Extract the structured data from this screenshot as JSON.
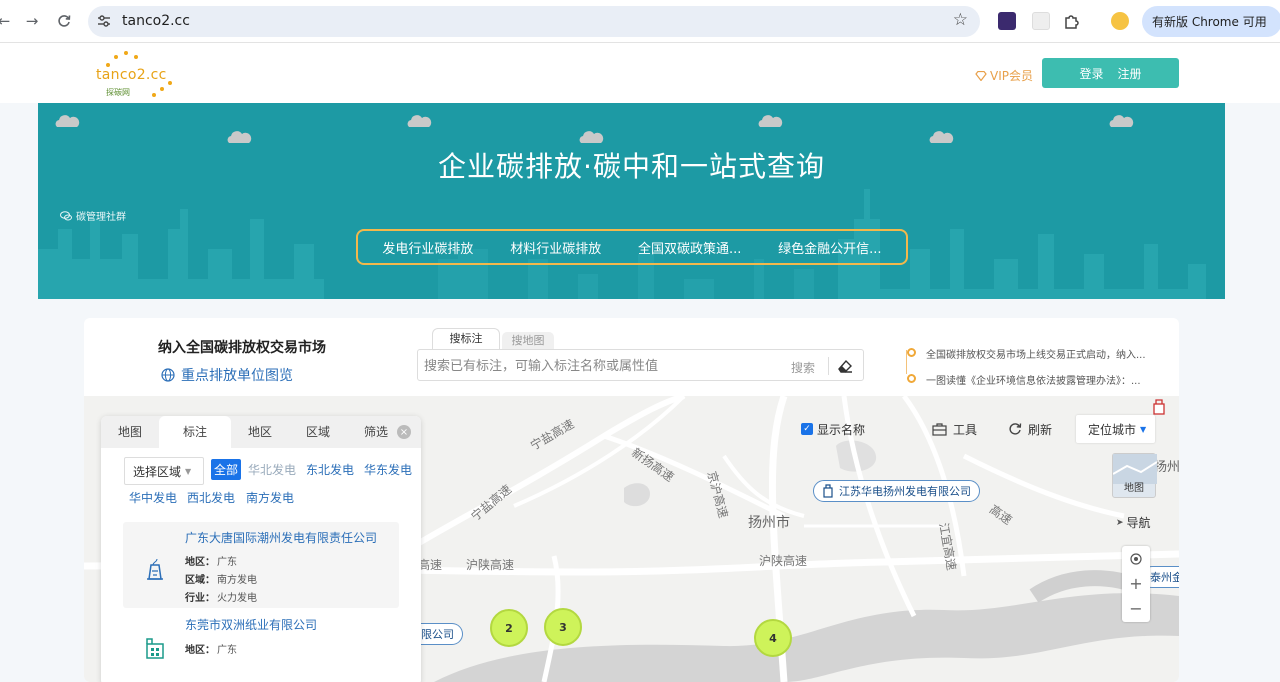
{
  "browser": {
    "url": "tanco2.cc",
    "update_label": "有新版 Chrome 可用"
  },
  "header": {
    "logo_text": "tanco2.cc",
    "logo_sub": "探碳网",
    "vip_label": "VIP会员",
    "login_label": "登录",
    "register_label": "注册"
  },
  "banner": {
    "title": "企业碳排放·碳中和一站式查询",
    "community": "碳管理社群",
    "tabs": [
      "发电行业碳排放",
      "材料行业碳排放",
      "全国双碳政策通...",
      "绿色金融公开信..."
    ]
  },
  "card": {
    "title": "纳入全国碳排放权交易市场",
    "subtitle": "重点排放单位图览",
    "search_tab_active": "搜标注",
    "search_tab_other": "搜地图",
    "search_placeholder": "搜索已有标注，可输入标注名称或属性值",
    "search_button": "搜索",
    "news": [
      "全国碳排放权交易市场上线交易正式启动，纳入...",
      "一图读懂《企业环境信息依法披露管理办法》：..."
    ]
  },
  "map": {
    "show_names_label": "显示名称",
    "tools_label": "工具",
    "refresh_label": "刷新",
    "city_label": "定位城市",
    "layer_label": "地图",
    "nav_label": "导航",
    "zoom_in": "+",
    "zoom_out": "−",
    "place_labels": {
      "yangzhou": "扬州市",
      "road1": "宁盐高速",
      "road2": "新扬高速",
      "road3": "沪陕高速",
      "road4": "沪陕高速",
      "road5": "宁盐高速",
      "road6": "京沪高速",
      "road7": "江宜高速",
      "road8": "高速",
      "road9": "高速",
      "road10": "扬州",
      "right_edge": "扬州"
    },
    "markers": {
      "jiangsu": "江苏华电扬州发电有限公司",
      "left_partial": "有限公司",
      "right_partial": "泰州金"
    },
    "clusters": [
      "2",
      "3",
      "4"
    ]
  },
  "panel": {
    "tabs": [
      "地图",
      "标注",
      "地区",
      "区域",
      "筛选"
    ],
    "active_tab_index": 1,
    "region_select": "选择区域",
    "regions": [
      "全部",
      "华北发电",
      "东北发电",
      "华东发电",
      "华中发电",
      "西北发电",
      "南方发电"
    ],
    "companies": [
      {
        "name": "广东大唐国际潮州发电有限责任公司",
        "region_label": "地区：",
        "region": "广东",
        "area_label": "区域：",
        "area": "南方发电",
        "industry_label": "行业：",
        "industry": "火力发电"
      },
      {
        "name": "东莞市双洲纸业有限公司",
        "region_label": "地区：",
        "region": "广东"
      }
    ]
  },
  "colors": {
    "teal": "#1d9aa4",
    "button": "#3dbdb0",
    "accent_orange": "#f2b84b",
    "link_blue": "#2c6fb8",
    "cluster": "#cef35a"
  }
}
